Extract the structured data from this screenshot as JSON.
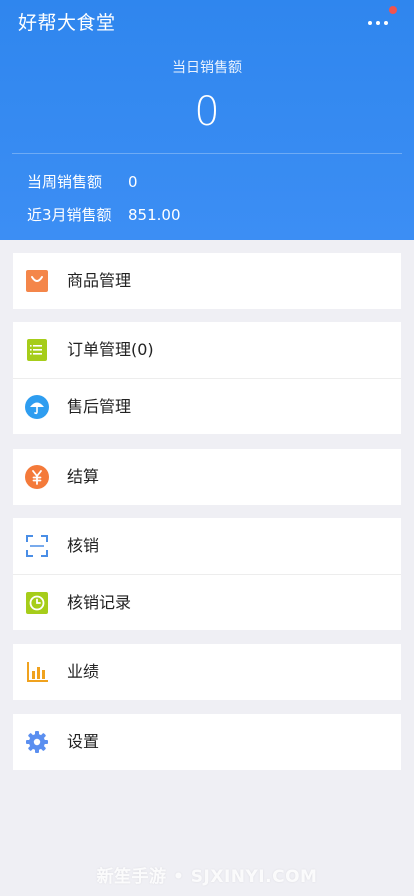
{
  "header": {
    "app_title": "好帮大食堂",
    "today_label": "当日销售额",
    "today_value": "0",
    "week_label": "当周销售额",
    "week_value": "0",
    "three_month_label": "近3月销售额",
    "three_month_value": "851.00"
  },
  "menu": {
    "goods": "商品管理",
    "orders": "订单管理(0)",
    "after_sales": "售后管理",
    "settlement": "结算",
    "verify": "核销",
    "verify_records": "核销记录",
    "performance": "业绩",
    "settings": "设置"
  },
  "watermark": "新笙手游 • SJXINYI.COM",
  "colors": {
    "header_blue": "#3389f0",
    "orange": "#f4864a",
    "lime": "#a6cd1a",
    "sky_blue": "#2e9df0",
    "scan_blue": "#4a8ee6",
    "chart_orange": "#f0a21e",
    "gear_blue": "#5b8ff0",
    "badge_red": "#f0544f"
  }
}
